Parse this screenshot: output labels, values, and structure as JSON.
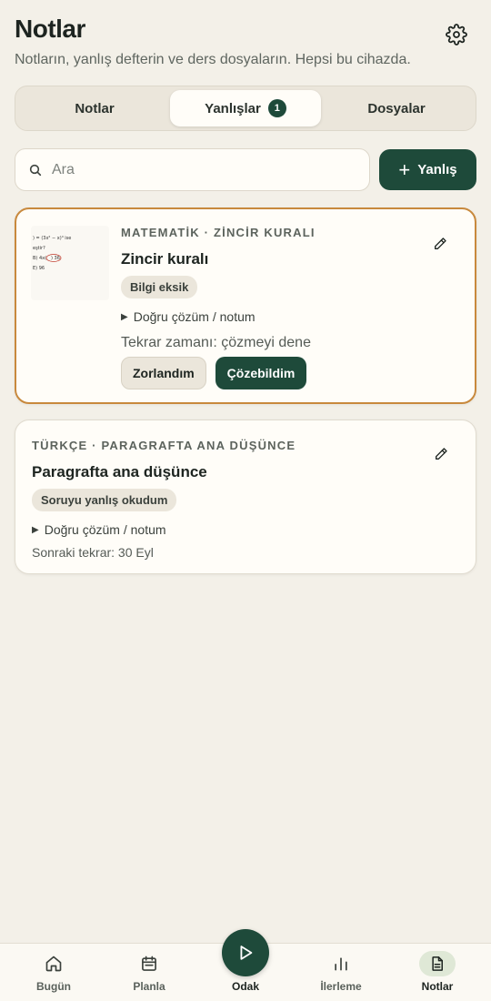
{
  "header": {
    "title": "Notlar",
    "subtitle": "Notların, yanlış defterin ve ders dosyaların. Hepsi bu cihazda.",
    "settings_icon": "gear-icon"
  },
  "tabs": [
    {
      "label": "Notlar",
      "active": false
    },
    {
      "label": "Yanlışlar",
      "active": true,
      "badge": "1"
    },
    {
      "label": "Dosyalar",
      "active": false
    }
  ],
  "search": {
    "placeholder": "Ara",
    "value": ""
  },
  "add_button": {
    "label": "Yanlış",
    "icon": "plus-icon"
  },
  "cards": [
    {
      "subject": "MATEMATİK · ZİNCİR KURALI",
      "title": "Zincir kuralı",
      "tag": "Bilgi eksik",
      "disclosure": "Doğru çözüm / notum",
      "review": "Tekrar zamanı: çözmeyi dene",
      "buttons": {
        "hard": "Zorlandım",
        "solved": "Çözebildim"
      },
      "thumbnail": {
        "lines": [
          ") = (3x² − x)⁴ ise",
          "eştir?",
          "B) 4x(",
          ") 36",
          "E) 96"
        ]
      }
    },
    {
      "subject": "TÜRKÇE · PARAGRAFTA ANA DÜŞÜNCE",
      "title": "Paragrafta ana düşünce",
      "tag": "Soruyu yanlış okudum",
      "disclosure": "Doğru çözüm / notum",
      "next_review": "Sonraki tekrar: 30 Eyl"
    }
  ],
  "bottom_nav": [
    {
      "label": "Bugün",
      "icon": "home-icon"
    },
    {
      "label": "Planla",
      "icon": "calendar-icon"
    },
    {
      "label": "Odak",
      "icon": "play-icon"
    },
    {
      "label": "İlerleme",
      "icon": "bar-chart-icon"
    },
    {
      "label": "Notlar",
      "icon": "document-icon",
      "active": true
    }
  ],
  "colors": {
    "accent": "#1e4a3a",
    "highlight_border": "#c8893d",
    "background": "#f3f0e8",
    "card": "#fffdf8"
  }
}
